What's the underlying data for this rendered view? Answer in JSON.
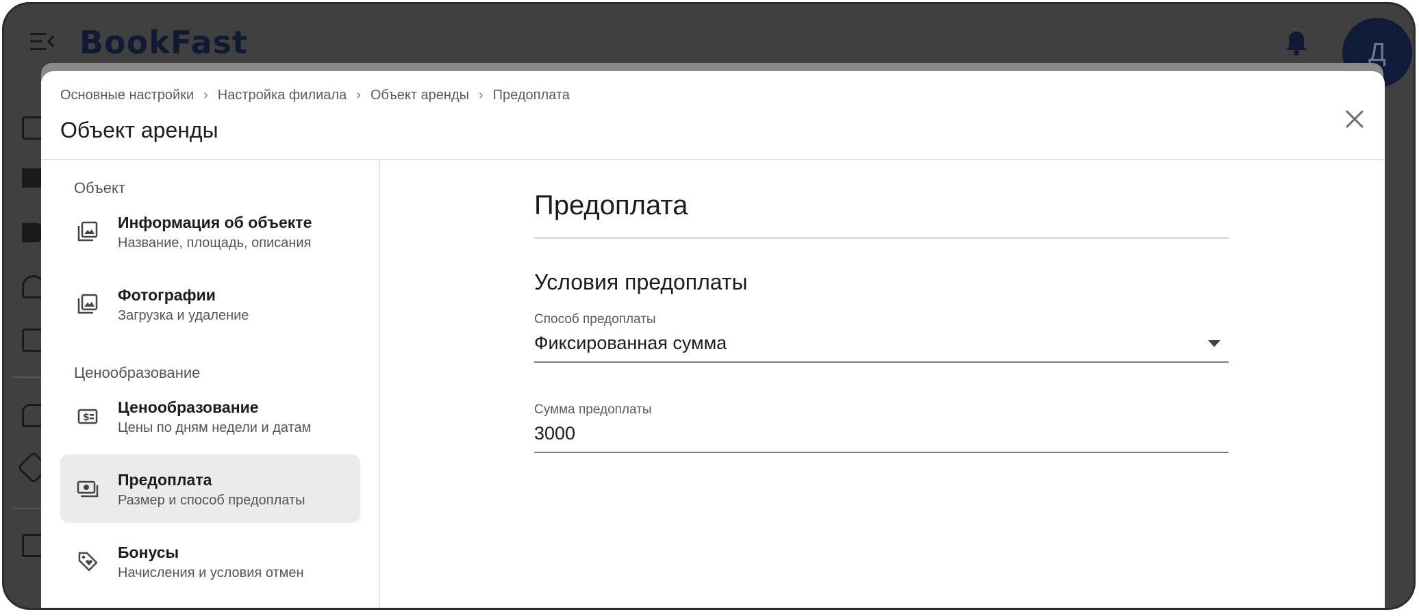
{
  "app": {
    "logo": "BookFast",
    "avatar_initial": "Д"
  },
  "modal": {
    "breadcrumb": [
      "Основные настройки",
      "Настройка филиала",
      "Объект аренды",
      "Предоплата"
    ],
    "breadcrumb_sep": "›",
    "title": "Объект аренды"
  },
  "sidebar": {
    "sections": [
      {
        "label": "Объект"
      },
      {
        "label": "Ценообразование"
      }
    ],
    "items": [
      {
        "title": "Информация об объекте",
        "subtitle": "Название, площадь, описания",
        "icon": "image-stack-icon",
        "active": false
      },
      {
        "title": "Фотографии",
        "subtitle": "Загрузка и удаление",
        "icon": "image-stack-icon",
        "active": false
      },
      {
        "title": "Ценообразование",
        "subtitle": "Цены по дням недели и датам",
        "icon": "price-tag-dollar-icon",
        "active": false
      },
      {
        "title": "Предоплата",
        "subtitle": "Размер и способ предоплаты",
        "icon": "cash-stack-icon",
        "active": true
      },
      {
        "title": "Бонусы",
        "subtitle": "Начисления и условия отмен",
        "icon": "tag-icon",
        "active": false
      }
    ]
  },
  "main": {
    "heading": "Предоплата",
    "section_heading": "Условия предоплаты",
    "fields": {
      "method": {
        "label": "Способ предоплаты",
        "value": "Фиксированная сумма"
      },
      "amount": {
        "label": "Сумма предоплаты",
        "value": "3000"
      }
    }
  },
  "colors": {
    "backdrop": "#404040",
    "active_item_bg": "#ebebeb",
    "avatar_bg": "#101b3a"
  }
}
